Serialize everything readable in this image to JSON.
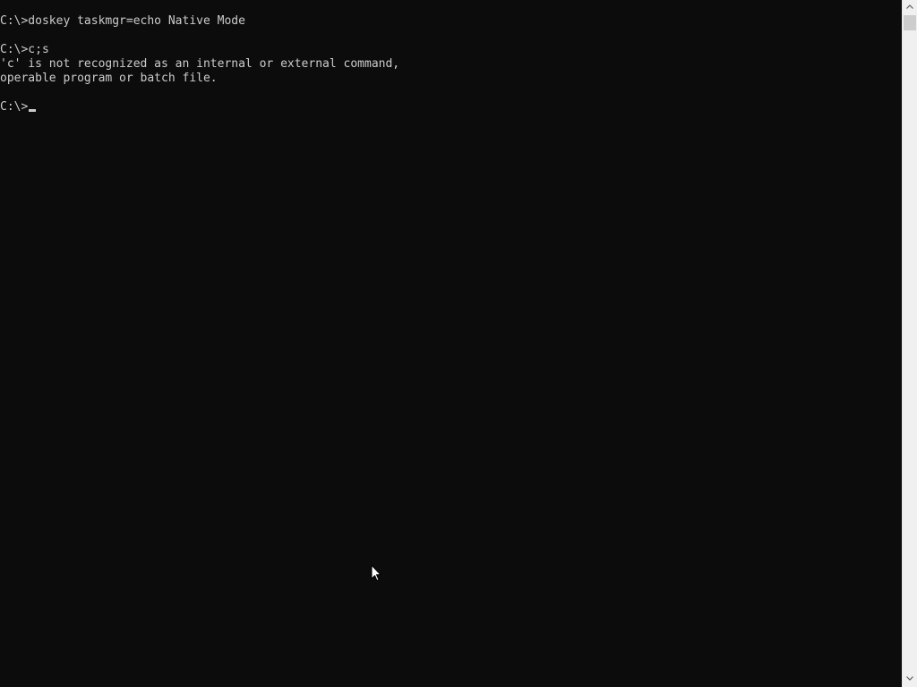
{
  "console": {
    "lines": [
      "C:\\>doskey taskmgr=echo Native Mode",
      "",
      "C:\\>c;s",
      "'c' is not recognized as an internal or external command,",
      "operable program or batch file.",
      ""
    ],
    "prompt": "C:\\>"
  },
  "scrollbar": {
    "up_icon": "chevron-up-icon",
    "down_icon": "chevron-down-icon"
  },
  "colors": {
    "background": "#0c0c0c",
    "text": "#cccccc",
    "scrollbar": "#f0f0f0",
    "thumb": "#cdcdcd"
  }
}
